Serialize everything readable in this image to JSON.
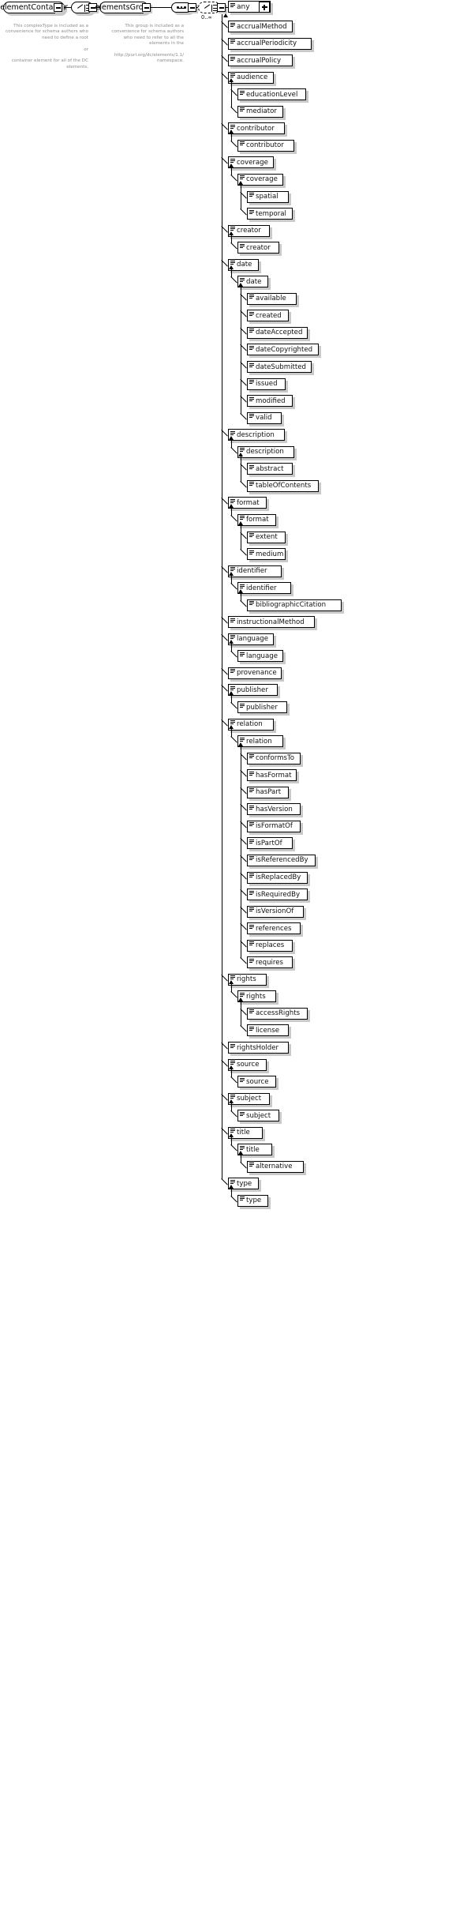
{
  "diagram": {
    "title": "elementContainer",
    "header": {
      "root_label": "elementContainer",
      "choice_label": "choice-icon",
      "group_label": "elementsGroup",
      "sequence_label": "sequence-icon",
      "any_label": "any",
      "cardinality": "0..∞"
    },
    "annotations": [
      {
        "id": "complextype-note",
        "text": "This complexType is included as a convenience for schema authors who need to define a root\n\nor\n\ncontainer element for all of the DC elements."
      },
      {
        "id": "group-note",
        "text": "This group is included as a convenience for schema authors\n who need to refer to all the elements in the\n\nhttp://purl.org/dc/elements/1.1/ namespace."
      }
    ],
    "elements": [
      {
        "label": "accrualMethod",
        "level": 0
      },
      {
        "label": "accrualPeriodicity",
        "level": 0
      },
      {
        "label": "accrualPolicy",
        "level": 0
      },
      {
        "label": "audience",
        "level": 0
      },
      {
        "label": "educationLevel",
        "level": 1
      },
      {
        "label": "mediator",
        "level": 1
      },
      {
        "label": "contributor",
        "level": 0
      },
      {
        "label": "contributor",
        "level": 1
      },
      {
        "label": "coverage",
        "level": 0
      },
      {
        "label": "coverage",
        "level": 1
      },
      {
        "label": "spatial",
        "level": 2
      },
      {
        "label": "temporal",
        "level": 2
      },
      {
        "label": "creator",
        "level": 0
      },
      {
        "label": "creator",
        "level": 1
      },
      {
        "label": "date",
        "level": 0
      },
      {
        "label": "date",
        "level": 1
      },
      {
        "label": "available",
        "level": 2
      },
      {
        "label": "created",
        "level": 2
      },
      {
        "label": "dateAccepted",
        "level": 2
      },
      {
        "label": "dateCopyrighted",
        "level": 2
      },
      {
        "label": "dateSubmitted",
        "level": 2
      },
      {
        "label": "issued",
        "level": 2
      },
      {
        "label": "modified",
        "level": 2
      },
      {
        "label": "valid",
        "level": 2
      },
      {
        "label": "description",
        "level": 0
      },
      {
        "label": "description",
        "level": 1
      },
      {
        "label": "abstract",
        "level": 2
      },
      {
        "label": "tableOfContents",
        "level": 2
      },
      {
        "label": "format",
        "level": 0
      },
      {
        "label": "format",
        "level": 1
      },
      {
        "label": "extent",
        "level": 2
      },
      {
        "label": "medium",
        "level": 2
      },
      {
        "label": "identifier",
        "level": 0
      },
      {
        "label": "identifier",
        "level": 1
      },
      {
        "label": "bibliographicCitation",
        "level": 2
      },
      {
        "label": "instructionalMethod",
        "level": 0
      },
      {
        "label": "language",
        "level": 0
      },
      {
        "label": "language",
        "level": 1
      },
      {
        "label": "provenance",
        "level": 0
      },
      {
        "label": "publisher",
        "level": 0
      },
      {
        "label": "publisher",
        "level": 1
      },
      {
        "label": "relation",
        "level": 0
      },
      {
        "label": "relation",
        "level": 1
      },
      {
        "label": "conformsTo",
        "level": 2
      },
      {
        "label": "hasFormat",
        "level": 2
      },
      {
        "label": "hasPart",
        "level": 2
      },
      {
        "label": "hasVersion",
        "level": 2
      },
      {
        "label": "isFormatOf",
        "level": 2
      },
      {
        "label": "isPartOf",
        "level": 2
      },
      {
        "label": "isReferencedBy",
        "level": 2
      },
      {
        "label": "isReplacedBy",
        "level": 2
      },
      {
        "label": "isRequiredBy",
        "level": 2
      },
      {
        "label": "isVersionOf",
        "level": 2
      },
      {
        "label": "references",
        "level": 2
      },
      {
        "label": "replaces",
        "level": 2
      },
      {
        "label": "requires",
        "level": 2
      },
      {
        "label": "rights",
        "level": 0
      },
      {
        "label": "rights",
        "level": 1
      },
      {
        "label": "accessRights",
        "level": 2
      },
      {
        "label": "license",
        "level": 2
      },
      {
        "label": "rightsHolder",
        "level": 0
      },
      {
        "label": "source",
        "level": 0
      },
      {
        "label": "source",
        "level": 1
      },
      {
        "label": "subject",
        "level": 0
      },
      {
        "label": "subject",
        "level": 1
      },
      {
        "label": "title",
        "level": 0
      },
      {
        "label": "title",
        "level": 1
      },
      {
        "label": "alternative",
        "level": 2
      },
      {
        "label": "type",
        "level": 0
      },
      {
        "label": "type",
        "level": 1
      }
    ]
  }
}
